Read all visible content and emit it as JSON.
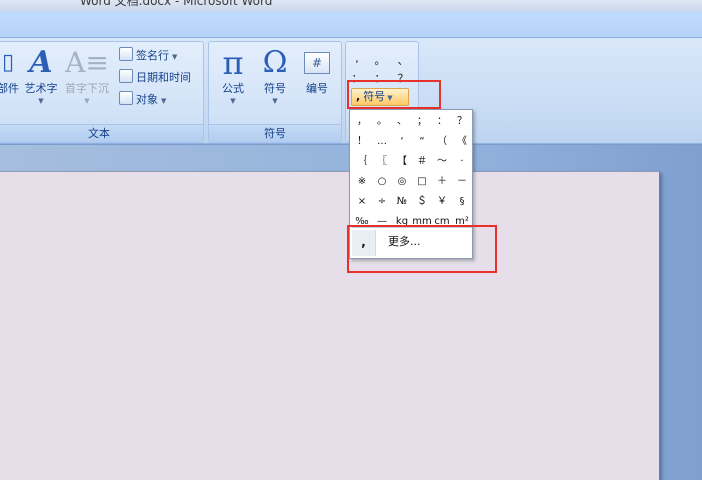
{
  "window": {
    "title": "Word 文档.docx - Microsoft Word"
  },
  "ribbon": {
    "text_group": {
      "label": "文本",
      "partial_label": "部件",
      "wordart_label": "艺术字",
      "dropcap_label": "首字下沉",
      "signature_label": "签名行",
      "datetime_label": "日期和时间",
      "object_label": "对象"
    },
    "symbols_group": {
      "label": "符号",
      "formula_label": "公式",
      "symbol_label": "符号",
      "number_label": "编号"
    },
    "special_symbols": {
      "quick_symbols": [
        ",",
        "。",
        "、",
        "：",
        "：",
        "？"
      ],
      "button_label": "符号",
      "button_icon": ","
    }
  },
  "symbol_dropdown": {
    "grid": [
      [
        "，",
        "。",
        "、",
        "；",
        "：",
        "？"
      ],
      [
        "！",
        "…",
        "‘",
        "“",
        "（",
        "《"
      ],
      [
        "｛",
        "〖",
        "【",
        "＃",
        "～",
        "·"
      ],
      [
        "※",
        "○",
        "◎",
        "□",
        "＋",
        "－"
      ],
      [
        "×",
        "÷",
        "№",
        "＄",
        "￥",
        "§"
      ],
      [
        "‰",
        "—",
        "kg",
        "mm",
        "cm",
        "m²"
      ]
    ],
    "more_label": "更多...",
    "more_icon": ","
  },
  "colors": {
    "highlight": "#e8312b",
    "ribbon_text": "#15428b",
    "button_active": "#ffc864"
  }
}
